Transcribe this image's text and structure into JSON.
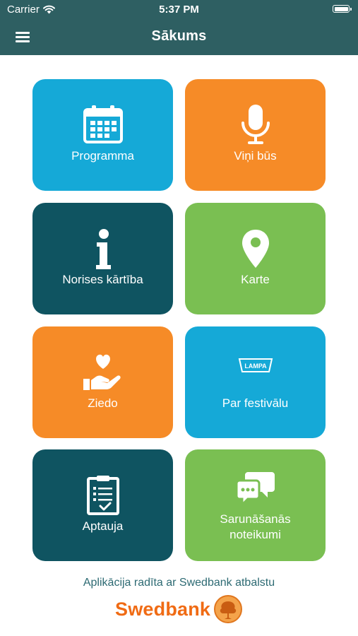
{
  "status_bar": {
    "carrier": "Carrier",
    "time": "5:37 PM"
  },
  "nav": {
    "title": "Sākums"
  },
  "tiles": [
    {
      "label": "Programma",
      "icon": "calendar-icon",
      "color": "#15a9d7"
    },
    {
      "label": "Viņi būs",
      "icon": "microphone-icon",
      "color": "#f68b27"
    },
    {
      "label": "Norises kārtība",
      "icon": "info-icon",
      "color": "#0f5461"
    },
    {
      "label": "Karte",
      "icon": "map-pin-icon",
      "color": "#7abf52"
    },
    {
      "label": "Ziedo",
      "icon": "heart-hand-icon",
      "color": "#f68b27"
    },
    {
      "label": "Par festivālu",
      "icon": "lampa-logo-icon",
      "color": "#15a9d7"
    },
    {
      "label": "Aptauja",
      "icon": "clipboard-icon",
      "color": "#0f5461"
    },
    {
      "label": "Sarunāšanās\nnoteikumi",
      "icon": "chat-bubbles-icon",
      "color": "#7abf52"
    }
  ],
  "logo_text": {
    "lampa": "LAMPA"
  },
  "footer": {
    "text": "Aplikācija radīta ar Swedbank atbalstu",
    "brand": "Swedbank"
  }
}
